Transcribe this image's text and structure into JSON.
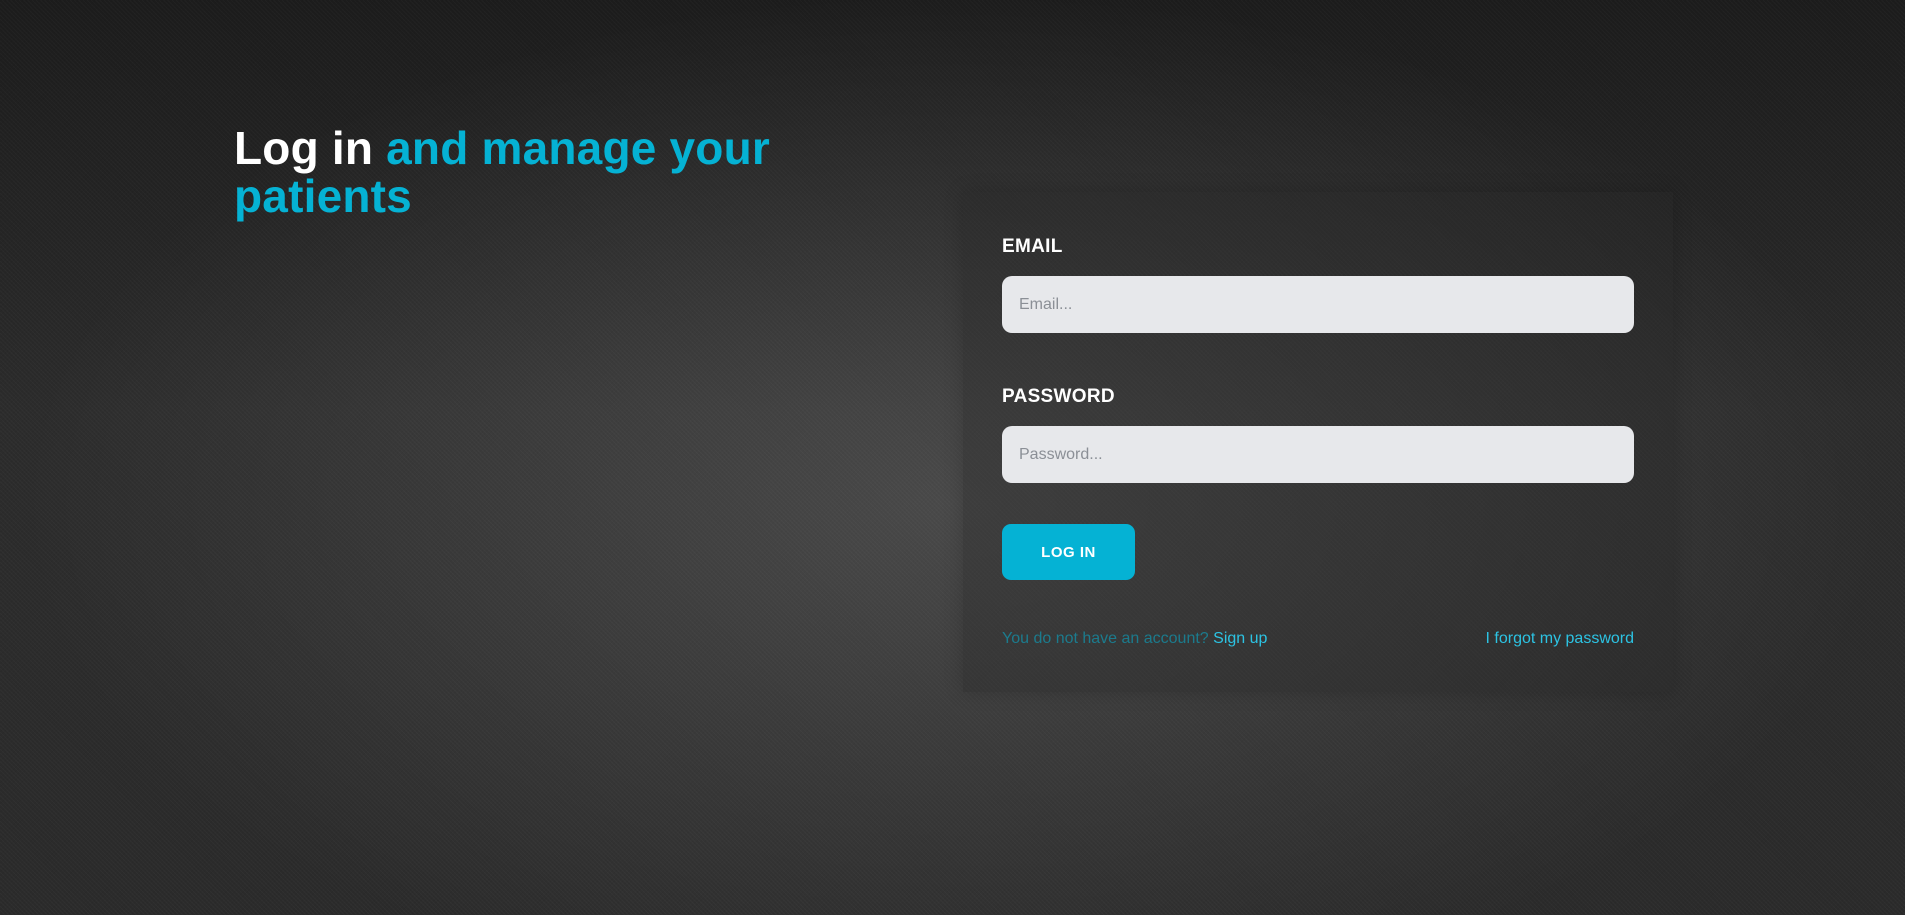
{
  "hero": {
    "title_white": "Log in",
    "title_accent": "and manage your patients"
  },
  "form": {
    "email_label": "EMAIL",
    "email_placeholder": "Email...",
    "email_value": "",
    "password_label": "PASSWORD",
    "password_placeholder": "Password...",
    "password_value": "",
    "login_button": "LOG IN"
  },
  "footer": {
    "no_account_text": "You do not have an account?",
    "signup_link": "Sign up",
    "forgot_password_link": "I forgot my password"
  },
  "colors": {
    "accent": "#05b2d4",
    "link": "#2cc3e3",
    "input_background": "#e7e8eb",
    "background": "#2e2e2e"
  }
}
